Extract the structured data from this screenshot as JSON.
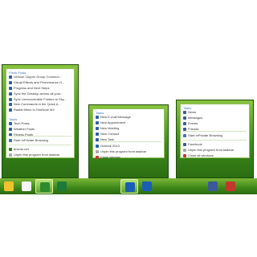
{
  "jumplists": [
    {
      "groups": [
        {
          "title": "Fresh Posts",
          "items": [
            {
              "label": "Version Clipper Group Commun...",
              "icon_color": "#2b5fa8",
              "icon": "page-icon"
            },
            {
              "label": "Visual Effects and Performance O...",
              "icon_color": "#2b5fa8",
              "icon": "page-icon"
            },
            {
              "label": "Progress and Next Steps",
              "icon_color": "#2b5fa8",
              "icon": "page-icon"
            },
            {
              "label": "Sync the Desktop across all your...",
              "icon_color": "#2b5fa8",
              "icon": "page-icon"
            },
            {
              "label": "Sync Unrecoverable Folders to Sky...",
              "icon_color": "#2b5fa8",
              "icon": "page-icon"
            },
            {
              "label": "New Commands in the Quick A...",
              "icon_color": "#2b5fa8",
              "icon": "page-icon"
            },
            {
              "label": "Radial Menu in OneNote MX",
              "icon_color": "#2b5fa8",
              "icon": "page-icon"
            }
          ]
        },
        {
          "title": "Tasks",
          "items": [
            {
              "label": "Tech Posts",
              "icon_color": "#2b5fa8",
              "icon": "star-icon"
            },
            {
              "label": "Weather Posts",
              "icon_color": "#2b5fa8",
              "icon": "star-icon"
            },
            {
              "label": "Fitness Posts",
              "icon_color": "#2b5fa8",
              "icon": "star-icon"
            }
          ]
        }
      ],
      "inprivate": "Start InPrivate Browsing",
      "footer": [
        {
          "label": "dnsme.net",
          "icon_color": "#2f7f1a",
          "icon": "site-icon"
        },
        {
          "label": "Unpin this program from taskbar",
          "icon_color": "#a8a8a8",
          "icon": "unpin-icon"
        }
      ]
    },
    {
      "groups": [
        {
          "title": "Tasks",
          "items": [
            {
              "label": "New E-mail Message",
              "icon_color": "#2b5fa8",
              "icon": "mail-icon"
            },
            {
              "label": "New Appointment",
              "icon_color": "#2b5fa8",
              "icon": "calendar-icon"
            },
            {
              "label": "New Meeting",
              "icon_color": "#2b5fa8",
              "icon": "meeting-icon"
            },
            {
              "label": "New Contact",
              "icon_color": "#2b5fa8",
              "icon": "contact-icon"
            },
            {
              "label": "New Task",
              "icon_color": "#2b5fa8",
              "icon": "task-icon"
            }
          ]
        }
      ],
      "footer": [
        {
          "label": "Outlook 2013",
          "icon_color": "#1a5fb4",
          "icon": "outlook-icon"
        },
        {
          "label": "Unpin this program from taskbar",
          "icon_color": "#a8a8a8",
          "icon": "unpin-icon"
        },
        {
          "label": "Close window",
          "icon_color": "#c0392b",
          "icon": "close-icon"
        }
      ]
    },
    {
      "groups": [
        {
          "title": "Tasks",
          "items": [
            {
              "label": "News",
              "icon_color": "#3b5998",
              "icon": "news-icon"
            },
            {
              "label": "Messages",
              "icon_color": "#3b5998",
              "icon": "messages-icon"
            },
            {
              "label": "Events",
              "icon_color": "#3b5998",
              "icon": "events-icon"
            },
            {
              "label": "Friends",
              "icon_color": "#3b5998",
              "icon": "friends-icon"
            }
          ]
        }
      ],
      "inprivate": "Start InPrivate Browsing",
      "footer": [
        {
          "label": "Facebook",
          "icon_color": "#3b5998",
          "icon": "facebook-icon"
        },
        {
          "label": "Unpin this program from taskbar",
          "icon_color": "#a8a8a8",
          "icon": "unpin-icon"
        },
        {
          "label": "Close all windows",
          "icon_color": "#c0392b",
          "icon": "close-icon"
        }
      ]
    }
  ],
  "taskbar": {
    "buttons": [
      {
        "name": "ie-pinned-button",
        "icon": "ie-icon",
        "color": "#f2c12e",
        "active": false
      },
      {
        "name": "site-pinned-button",
        "icon": "site-icon",
        "color": "#f5f5f5",
        "active": false
      },
      {
        "name": "dnsme-pinned-button",
        "icon": "globe-icon",
        "color": "#2d8a2d",
        "active": true
      },
      {
        "name": "excel-button",
        "icon": "excel-icon",
        "color": "#1d7a3a",
        "active": false
      },
      {
        "name": "outlook-button",
        "icon": "outlook-icon",
        "color": "#1a5fb4",
        "active": true
      },
      {
        "name": "outlook-taskbar-button",
        "icon": "outlook-icon",
        "color": "#1a5fb4",
        "active": false
      },
      {
        "name": "facebook-button",
        "icon": "facebook-icon",
        "color": "#3b5998",
        "active": false
      },
      {
        "name": "photos-button",
        "icon": "photos-icon",
        "color": "#c0392b",
        "active": false
      }
    ]
  }
}
